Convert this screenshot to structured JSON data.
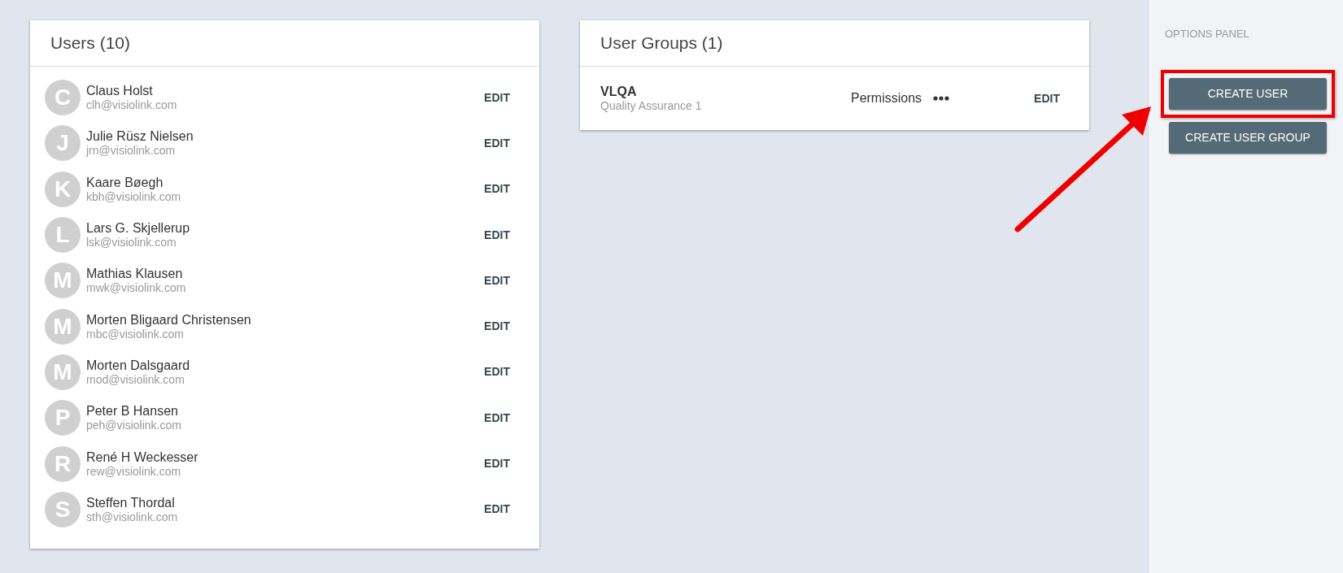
{
  "users_panel": {
    "title": "Users (10)",
    "users": [
      {
        "initial": "C",
        "name": "Claus Holst",
        "email": "clh@visiolink.com",
        "action": "EDIT"
      },
      {
        "initial": "J",
        "name": "Julie Rüsz Nielsen",
        "email": "jrn@visiolink.com",
        "action": "EDIT"
      },
      {
        "initial": "K",
        "name": "Kaare Bøegh",
        "email": "kbh@visiolink.com",
        "action": "EDIT"
      },
      {
        "initial": "L",
        "name": "Lars G. Skjellerup",
        "email": "lsk@visiolink.com",
        "action": "EDIT"
      },
      {
        "initial": "M",
        "name": "Mathias Klausen",
        "email": "mwk@visiolink.com",
        "action": "EDIT"
      },
      {
        "initial": "M",
        "name": "Morten Bligaard Christensen",
        "email": "mbc@visiolink.com",
        "action": "EDIT"
      },
      {
        "initial": "M",
        "name": "Morten Dalsgaard",
        "email": "mod@visiolink.com",
        "action": "EDIT"
      },
      {
        "initial": "P",
        "name": "Peter B Hansen",
        "email": "peh@visiolink.com",
        "action": "EDIT"
      },
      {
        "initial": "R",
        "name": "René H Weckesser",
        "email": "rew@visiolink.com",
        "action": "EDIT"
      },
      {
        "initial": "S",
        "name": "Steffen Thordal",
        "email": "sth@visiolink.com",
        "action": "EDIT"
      }
    ]
  },
  "groups_panel": {
    "title": "User Groups (1)",
    "groups": [
      {
        "name": "VLQA",
        "description": "Quality Assurance 1",
        "permissions": "Permissions",
        "action": "EDIT"
      }
    ]
  },
  "options_panel": {
    "title": "OPTIONS PANEL",
    "buttons": [
      {
        "label": "CREATE USER",
        "highlighted": true
      },
      {
        "label": "CREATE USER GROUP",
        "highlighted": false
      }
    ]
  }
}
